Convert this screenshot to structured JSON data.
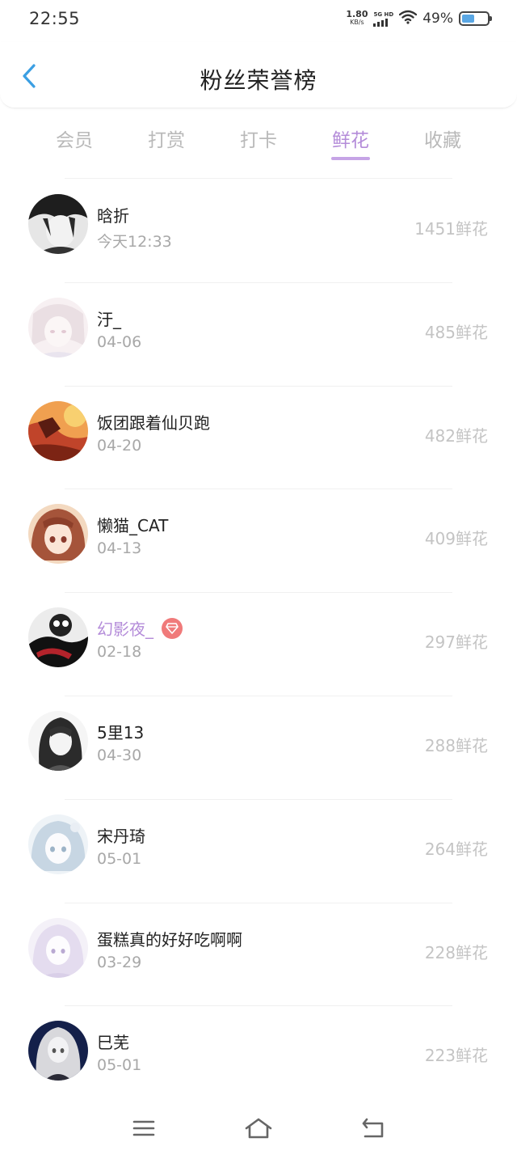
{
  "status_bar": {
    "time": "22:55",
    "net_speed": "1.80",
    "net_unit": "KB/s",
    "net_type": "5G HD",
    "battery_percent": "49%",
    "battery_level": 0.49,
    "icons": [
      "signal-icon",
      "wifi-icon",
      "battery-icon"
    ]
  },
  "header": {
    "title": "粉丝荣誉榜",
    "back_icon": "chevron-left-icon",
    "accent_color": "#3b9fe3"
  },
  "tabs": {
    "items": [
      {
        "label": "会员",
        "active": false
      },
      {
        "label": "打赏",
        "active": false
      },
      {
        "label": "打卡",
        "active": false
      },
      {
        "label": "鲜花",
        "active": true
      },
      {
        "label": "收藏",
        "active": false
      }
    ],
    "active_color": "#b48cd9"
  },
  "list": {
    "rows": [
      {
        "name": "晗折",
        "date": "今天12:33",
        "count": "1451鲜花"
      },
      {
        "name": "汙_",
        "date": "04-06",
        "count": "485鲜花"
      },
      {
        "name": "饭团跟着仙贝跑",
        "date": "04-20",
        "count": "482鲜花"
      },
      {
        "name": "懒猫_CAT",
        "date": "04-13",
        "count": "409鲜花"
      },
      {
        "name": "幻影夜_",
        "date": "02-18",
        "count": "297鲜花",
        "vip": true,
        "badge_icon": "diamond-icon"
      },
      {
        "name": "5里13",
        "date": "04-30",
        "count": "288鲜花"
      },
      {
        "name": "宋丹琦",
        "date": "05-01",
        "count": "264鲜花"
      },
      {
        "name": "蛋糕真的好好吃啊啊",
        "date": "03-29",
        "count": "228鲜花"
      },
      {
        "name": "巳芜",
        "date": "05-01",
        "count": "223鲜花"
      }
    ]
  },
  "nav_bar": {
    "icons": [
      "menu-icon",
      "home-icon",
      "back-icon"
    ]
  }
}
